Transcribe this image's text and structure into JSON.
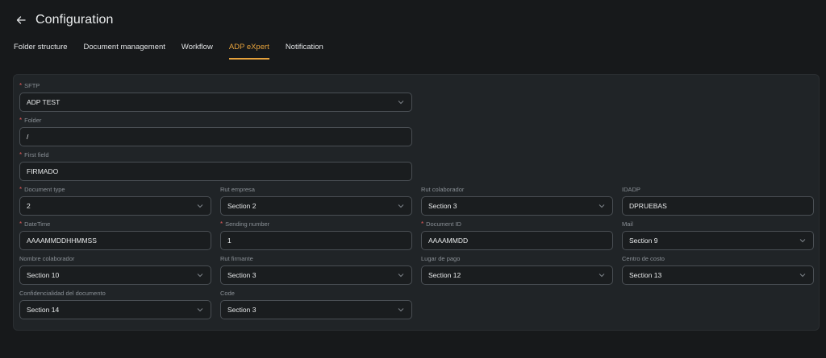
{
  "header": {
    "title": "Configuration"
  },
  "tabs": [
    {
      "label": "Folder structure"
    },
    {
      "label": "Document management"
    },
    {
      "label": "Workflow"
    },
    {
      "label": "ADP eXpert"
    },
    {
      "label": "Notification"
    }
  ],
  "form": {
    "sftp": {
      "label": "SFTP",
      "value": "ADP TEST"
    },
    "folder": {
      "label": "Folder",
      "value": "/"
    },
    "first_field": {
      "label": "First field",
      "value": "FIRMADO"
    },
    "row1": [
      {
        "label": "Document type",
        "value": "2"
      },
      {
        "label": "Rut empresa",
        "value": "Section 2"
      },
      {
        "label": "Rut colaborador",
        "value": "Section 3"
      },
      {
        "label": "IDADP",
        "value": "DPRUEBAS"
      }
    ],
    "row2": [
      {
        "label": "DateTime",
        "value": "AAAAMMDDHHMMSS"
      },
      {
        "label": "Sending number",
        "value": "1"
      },
      {
        "label": "Document ID",
        "value": "AAAAMMDD"
      },
      {
        "label": "Mail",
        "value": "Section 9"
      }
    ],
    "row3": [
      {
        "label": "Nombre colaborador",
        "value": "Section 10"
      },
      {
        "label": "Rut firmante",
        "value": "Section 3"
      },
      {
        "label": "Lugar de pago",
        "value": "Section 12"
      },
      {
        "label": "Centro de costo",
        "value": "Section 13"
      }
    ],
    "row4": [
      {
        "label": "Confidencialidad del documento",
        "value": "Section 14"
      },
      {
        "label": "Code",
        "value": "Section 3"
      }
    ]
  },
  "colors": {
    "accent": "#e6a23c",
    "required": "#e35a5a"
  }
}
